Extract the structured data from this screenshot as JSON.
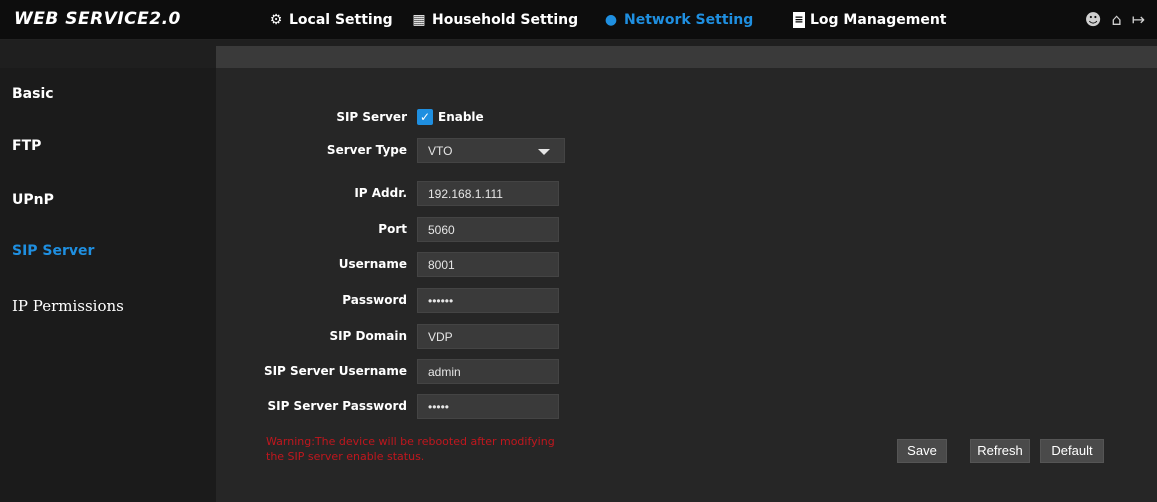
{
  "app": {
    "logo": "WEB SERVICE2.0"
  },
  "nav": [
    {
      "label": "Local Setting",
      "icon": "gear-icon"
    },
    {
      "label": "Household Setting",
      "icon": "building-icon"
    },
    {
      "label": "Network Setting",
      "icon": "globe-icon"
    },
    {
      "label": "Log Management",
      "icon": "document-icon"
    }
  ],
  "top_icons": [
    "user-icon",
    "home-icon",
    "logout-icon"
  ],
  "sidebar": {
    "items": [
      {
        "label": "Basic"
      },
      {
        "label": "FTP"
      },
      {
        "label": "UPnP"
      },
      {
        "label": "SIP Server"
      },
      {
        "label": "IP Permissions"
      }
    ],
    "active": "SIP Server"
  },
  "form": {
    "sip_server": {
      "label": "SIP Server",
      "checkbox_label": "Enable",
      "checked": true
    },
    "server_type": {
      "label": "Server Type",
      "value": "VTO"
    },
    "ip_addr": {
      "label": "IP Addr.",
      "value": "192.168.1.111"
    },
    "port": {
      "label": "Port",
      "value": "5060"
    },
    "username": {
      "label": "Username",
      "value": "8001"
    },
    "password": {
      "label": "Password",
      "value": "••••••"
    },
    "sip_domain": {
      "label": "SIP Domain",
      "value": "VDP"
    },
    "sip_server_username": {
      "label": "SIP Server Username",
      "value": "admin"
    },
    "sip_server_password": {
      "label": "SIP Server Password",
      "value": "•••••"
    }
  },
  "warning": "Warning:The device will be rebooted after modifying the SIP server enable status.",
  "buttons": {
    "save": "Save",
    "refresh": "Refresh",
    "default": "Default"
  },
  "colors": {
    "accent": "#1f8fe0",
    "warning": "#c0171e"
  }
}
